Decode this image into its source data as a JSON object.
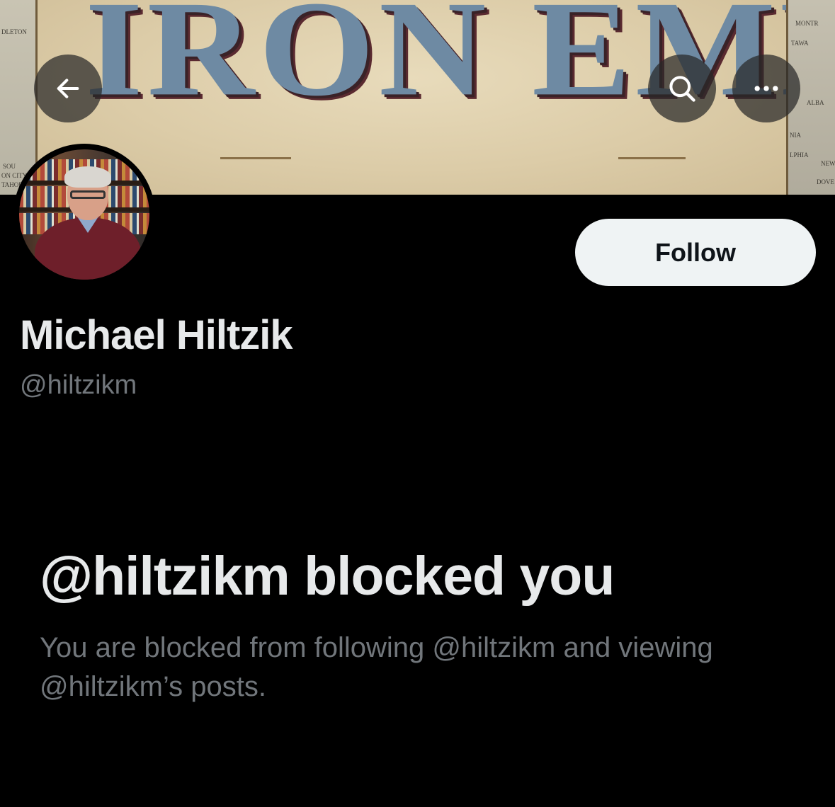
{
  "banner": {
    "title": "IRON EMPIRES",
    "map_labels_left": [
      "DLETON",
      "SOU",
      "ON CITY",
      "TAHOE"
    ],
    "map_labels_right": [
      "MONTR",
      "TAWA",
      "ALBA",
      "NIA",
      "LPHIA",
      "NEW",
      "DOVE"
    ]
  },
  "nav": {
    "back_icon": "arrow-left-icon",
    "search_icon": "search-icon",
    "more_icon": "more-horizontal-icon"
  },
  "profile": {
    "display_name": "Michael Hiltzik",
    "handle": "@hiltzikm",
    "follow_label": "Follow"
  },
  "blocked": {
    "title": "@hiltzikm blocked you",
    "description": "You are blocked from following @hiltzikm and viewing @hiltzikm’s posts."
  },
  "colors": {
    "background": "#000000",
    "primary_text": "#e7e9ea",
    "secondary_text": "#71767b",
    "follow_button_bg": "#eff3f4"
  }
}
